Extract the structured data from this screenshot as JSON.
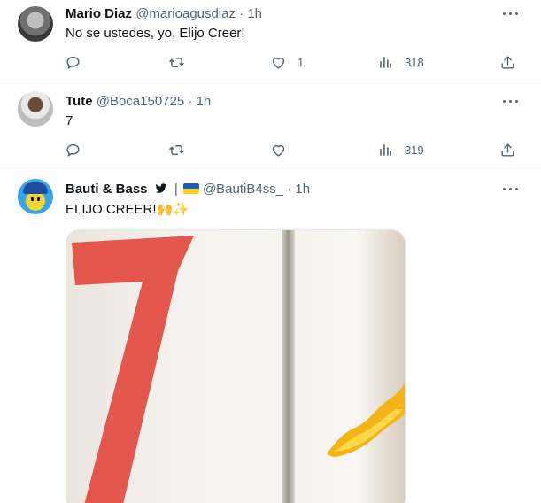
{
  "tweets": [
    {
      "name": "Mario Diaz",
      "handle": "@marioagusdiaz",
      "dot": "·",
      "time": "1h",
      "text": "No se ustedes, yo, Elijo Creer!",
      "reply_count": "",
      "retweet_count": "",
      "like_count": "1",
      "view_count": "318"
    },
    {
      "name": "Tute",
      "handle": "@Boca150725",
      "dot": "·",
      "time": "1h",
      "text": "7",
      "reply_count": "",
      "retweet_count": "",
      "like_count": "",
      "view_count": "319"
    },
    {
      "name": "Bauti & Bass",
      "separator": "|",
      "handle": "@BautiB4ss_",
      "dot": "·",
      "time": "1h",
      "text": "ELIJO CREER!",
      "text_emoji": "🙌✨"
    }
  ],
  "icons": {
    "reply": "reply-icon",
    "retweet": "retweet-icon",
    "like": "heart-icon",
    "views": "views-icon",
    "share": "share-icon",
    "more": "more-icon",
    "verified": "bird-verified-icon",
    "flag": "ukraine-flag-icon"
  },
  "colors": {
    "text": "#0f1419",
    "secondary": "#536471",
    "divider": "#eff3f4",
    "jersey_number": "#e24a3f"
  }
}
